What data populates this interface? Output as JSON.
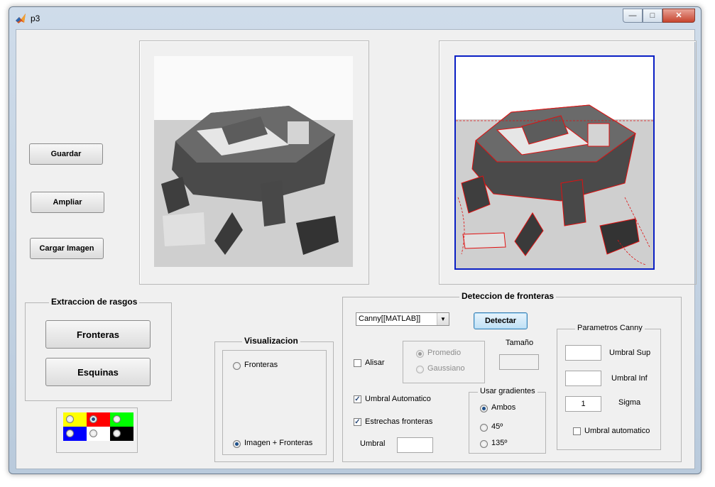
{
  "window": {
    "title": "p3",
    "minimize": "—",
    "maximize": "□",
    "close": "✕"
  },
  "left_buttons": {
    "guardar": "Guardar",
    "ampliar": "Ampliar",
    "cargar": "Cargar Imagen"
  },
  "extraccion": {
    "title": "Extraccion de rasgos",
    "fronteras": "Fronteras",
    "esquinas": "Esquinas"
  },
  "color_palette": {
    "colors": [
      "#ffff00",
      "#ff0000",
      "#00ff00",
      "#0000ff",
      "#ffffff",
      "#000000"
    ],
    "selected": "#ff0000"
  },
  "visualizacion": {
    "title": "Visualizacion",
    "opt1": "Fronteras",
    "opt2": "Imagen + Fronteras",
    "selected": "Imagen + Fronteras"
  },
  "deteccion": {
    "title": "Deteccion de fronteras",
    "method_select": "Canny[[MATLAB]]",
    "detectar": "Detectar",
    "alisar": "Alisar",
    "promedio": "Promedio",
    "gaussiano": "Gaussiano",
    "tamano_label": "Tamaño",
    "umbral_automatico": "Umbral Automatico",
    "estrechas": "Estrechas fronteras",
    "umbral_label": "Umbral",
    "gradientes": {
      "title": "Usar gradientes",
      "ambos": "Ambos",
      "g45": "45º",
      "g135": "135º"
    }
  },
  "canny": {
    "title": "Parametros Canny",
    "umbral_sup": "Umbral Sup",
    "umbral_inf": "Umbral Inf",
    "sigma": "Sigma",
    "sigma_value": "1",
    "umbral_auto": "Umbral automatico"
  },
  "icons": {
    "app": "matlab-icon",
    "dropdown": "chevron-down-icon"
  }
}
